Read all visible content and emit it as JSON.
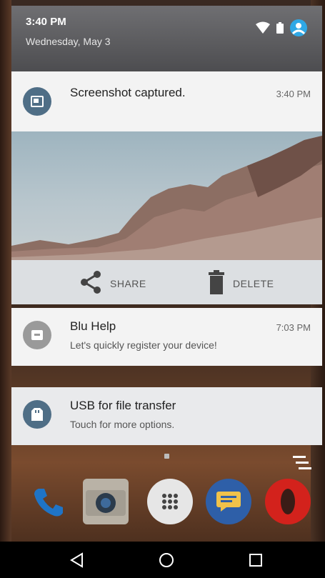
{
  "status_bar": {
    "time": "3:40 PM",
    "date": "Wednesday, May 3",
    "icons": [
      "wifi-icon",
      "battery-icon",
      "account-icon"
    ]
  },
  "notifications": [
    {
      "app_icon": "screenshot-icon",
      "title": "Screenshot captured.",
      "time": "3:40 PM",
      "actions": [
        {
          "icon": "share-icon",
          "label": "SHARE"
        },
        {
          "icon": "trash-icon",
          "label": "DELETE"
        }
      ]
    },
    {
      "app_icon": "help-icon",
      "title": "Blu Help",
      "subtitle": "Let's quickly register your device!",
      "time": "7:03 PM"
    },
    {
      "app_icon": "usb-icon",
      "title": "USB for file transfer",
      "subtitle": "Touch for more options."
    }
  ],
  "dock_apps": [
    {
      "name": "phone-icon"
    },
    {
      "name": "camera-icon"
    },
    {
      "name": "app-drawer-icon"
    },
    {
      "name": "messages-icon"
    },
    {
      "name": "opera-icon"
    }
  ],
  "nav": {
    "buttons": [
      "back-icon",
      "home-icon",
      "recents-icon"
    ]
  },
  "colors": {
    "shade_header": "#5a5a5d",
    "card_bg": "#f3f3f3",
    "icon_blue": "#4f6e86",
    "icon_grey": "#9a9a9a",
    "accent_cyan": "#2fa8e6"
  }
}
